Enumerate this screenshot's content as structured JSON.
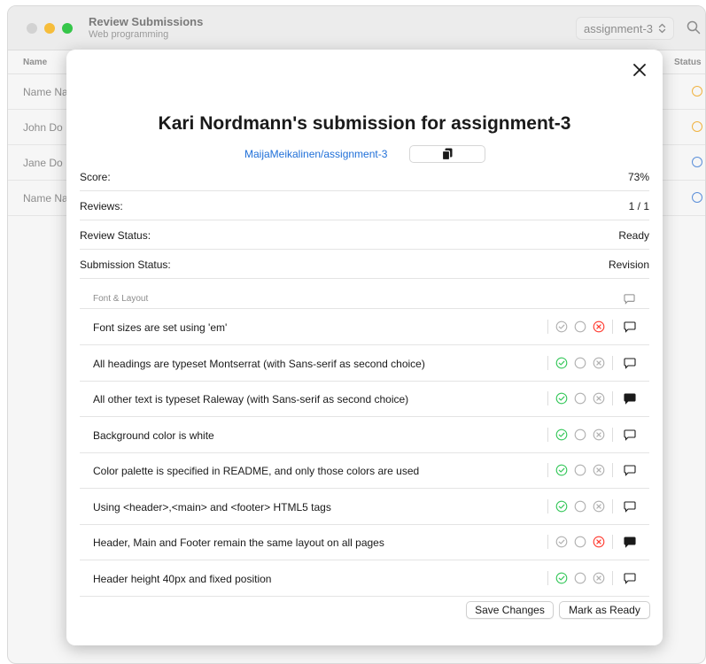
{
  "window": {
    "title": "Review Submissions",
    "subtitle": "Web programming",
    "assignment_select": "assignment-3",
    "list_headers": {
      "name": "Name",
      "status": "Status"
    },
    "rows": [
      {
        "name": "Name Na",
        "status_color": "#f0b341"
      },
      {
        "name": "John Do",
        "status_color": "#f0b341"
      },
      {
        "name": "Jane Do",
        "status_color": "#5b8fd9"
      },
      {
        "name": "Name Na",
        "status_color": "#5b8fd9"
      }
    ]
  },
  "modal": {
    "title": "Kari Nordmann's submission for assignment-3",
    "repo_link": "MaijaMeikalinen/assignment-3",
    "info": [
      {
        "label": "Score:",
        "value": "73%"
      },
      {
        "label": "Reviews:",
        "value": "1 / 1"
      },
      {
        "label": "Review Status:",
        "value": "Ready"
      },
      {
        "label": "Submission Status:",
        "value": "Revision"
      }
    ],
    "section_title": "Font & Layout",
    "criteria": [
      {
        "text": "Font sizes are set using 'em'",
        "state": "fail",
        "comment_filled": false
      },
      {
        "text": "All headings are typeset Montserrat (with Sans-serif as second choice)",
        "state": "pass",
        "comment_filled": false
      },
      {
        "text": "All other text is typeset Raleway (with Sans-serif as second choice)",
        "state": "pass",
        "comment_filled": true
      },
      {
        "text": "Background color is white",
        "state": "pass",
        "comment_filled": false
      },
      {
        "text": "Color palette is specified in README, and only those colors are used",
        "state": "pass",
        "comment_filled": false
      },
      {
        "text": "Using <header>,<main> and <footer> HTML5 tags",
        "state": "pass",
        "comment_filled": false
      },
      {
        "text": "Header, Main and Footer remain the same layout on all pages",
        "state": "fail",
        "comment_filled": true
      },
      {
        "text": "Header height 40px and fixed position",
        "state": "pass",
        "comment_filled": false
      }
    ],
    "buttons": {
      "save": "Save Changes",
      "ready": "Mark as Ready"
    }
  },
  "colors": {
    "pass": "#34c759",
    "fail": "#ff3b30",
    "neutral": "#b0b0b0",
    "link": "#1f6fd8"
  }
}
